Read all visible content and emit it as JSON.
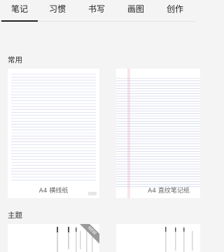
{
  "tabs": [
    {
      "label": "笔记",
      "active": true
    },
    {
      "label": "习惯",
      "active": false
    },
    {
      "label": "书写",
      "active": false
    },
    {
      "label": "画图",
      "active": false
    },
    {
      "label": "创作",
      "active": false
    }
  ],
  "sections": {
    "common": {
      "title": "常用"
    },
    "themes": {
      "title": "主题"
    }
  },
  "templates": [
    {
      "label": "A4 横线纸",
      "style": "lined",
      "line_color": "#cfd2ea"
    },
    {
      "label": "A4 直纹笔记纸",
      "style": "ruled-margin",
      "line_color": "#c9cde6",
      "margin_color": "#e6a8b8"
    }
  ],
  "theme_cards": [
    {
      "badge": "NEW"
    },
    {
      "badge": ""
    }
  ],
  "colors": {
    "active_tab_underline": "#222222",
    "background": "#f4f4f5"
  }
}
